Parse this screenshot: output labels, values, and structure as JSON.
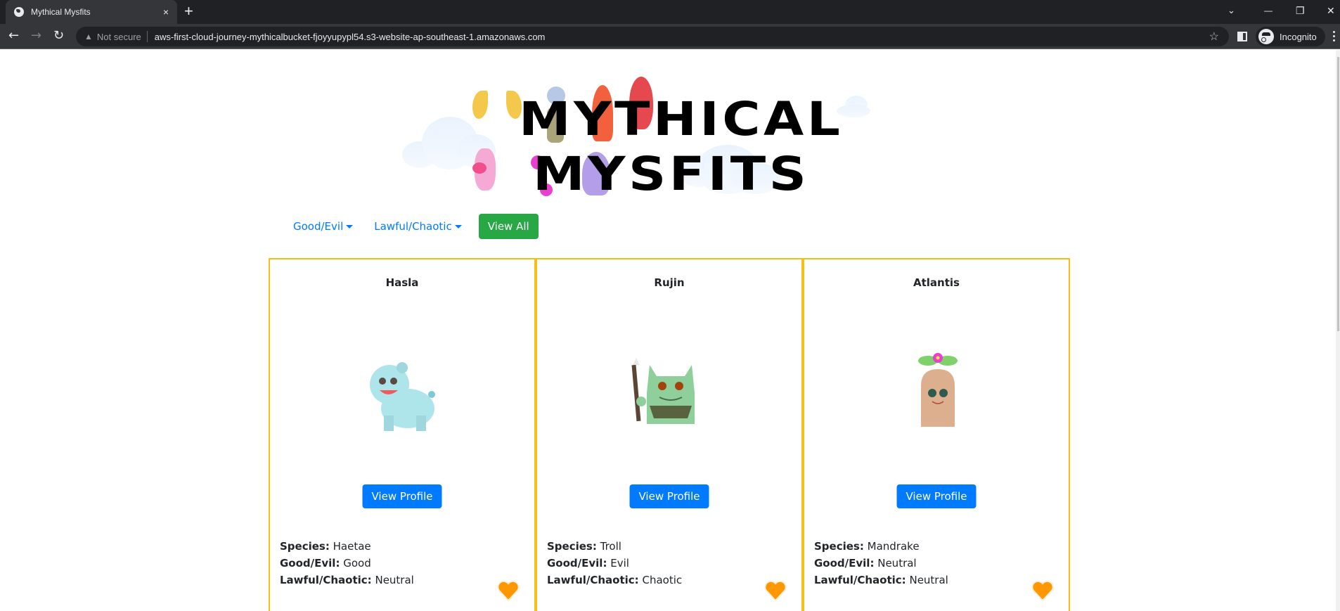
{
  "browser": {
    "tab_title": "Mythical Mysfits",
    "tab_close": "×",
    "new_tab": "+",
    "back": "←",
    "forward": "→",
    "reload": "↻",
    "security_warning": "▲",
    "security_label": "Not secure",
    "url": "aws-first-cloud-journey-mythicalbucket-fjoyyupypl54.s3-website-ap-southeast-1.amazonaws.com",
    "bookmark": "☆",
    "profile_label": "Incognito",
    "tab_search": "⌄",
    "minimize": "—",
    "restore": "❐",
    "close": "✕"
  },
  "header": {
    "logo_line1": "MYTHICAL",
    "logo_line2": "MYSFITS"
  },
  "filters": {
    "good_evil_label": "Good/Evil",
    "lawful_chaotic_label": "Lawful/Chaotic",
    "view_all_label": "View All"
  },
  "labels": {
    "species": "Species:",
    "good_evil": "Good/Evil:",
    "lawful_chaotic": "Lawful/Chaotic:",
    "view_profile": "View Profile"
  },
  "colors": {
    "accent_blue": "#007bff",
    "view_all_green": "#28a745",
    "card_border": "#f5c015",
    "heart": "#ff9800"
  },
  "mysfits": [
    {
      "name": "Hasla",
      "species": "Haetae",
      "good_evil": "Good",
      "lawful_chaotic": "Neutral",
      "creature": "haetae"
    },
    {
      "name": "Rujin",
      "species": "Troll",
      "good_evil": "Evil",
      "lawful_chaotic": "Chaotic",
      "creature": "troll"
    },
    {
      "name": "Atlantis",
      "species": "Mandrake",
      "good_evil": "Neutral",
      "lawful_chaotic": "Neutral",
      "creature": "mandrake"
    }
  ]
}
